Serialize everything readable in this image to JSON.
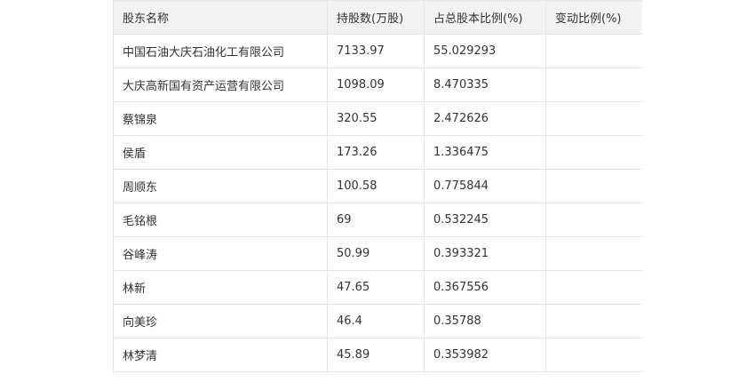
{
  "table": {
    "headers": [
      "股东名称",
      "持股数(万股)",
      "占总股本比例(%)",
      "变动比例(%)"
    ],
    "rows": [
      [
        "中国石油大庆石油化工有限公司",
        "7133.97",
        "55.029293",
        ""
      ],
      [
        "大庆高新国有资产运营有限公司",
        "1098.09",
        "8.470335",
        ""
      ],
      [
        "蔡锦泉",
        "320.55",
        "2.472626",
        ""
      ],
      [
        "侯盾",
        "173.26",
        "1.336475",
        ""
      ],
      [
        "周顺东",
        "100.58",
        "0.775844",
        ""
      ],
      [
        "毛铭根",
        "69",
        "0.532245",
        ""
      ],
      [
        "谷峰涛",
        "50.99",
        "0.393321",
        ""
      ],
      [
        "林新",
        "47.65",
        "0.367556",
        ""
      ],
      [
        "向美珍",
        "46.4",
        "0.35788",
        ""
      ],
      [
        "林梦清",
        "45.89",
        "0.353982",
        ""
      ]
    ]
  }
}
